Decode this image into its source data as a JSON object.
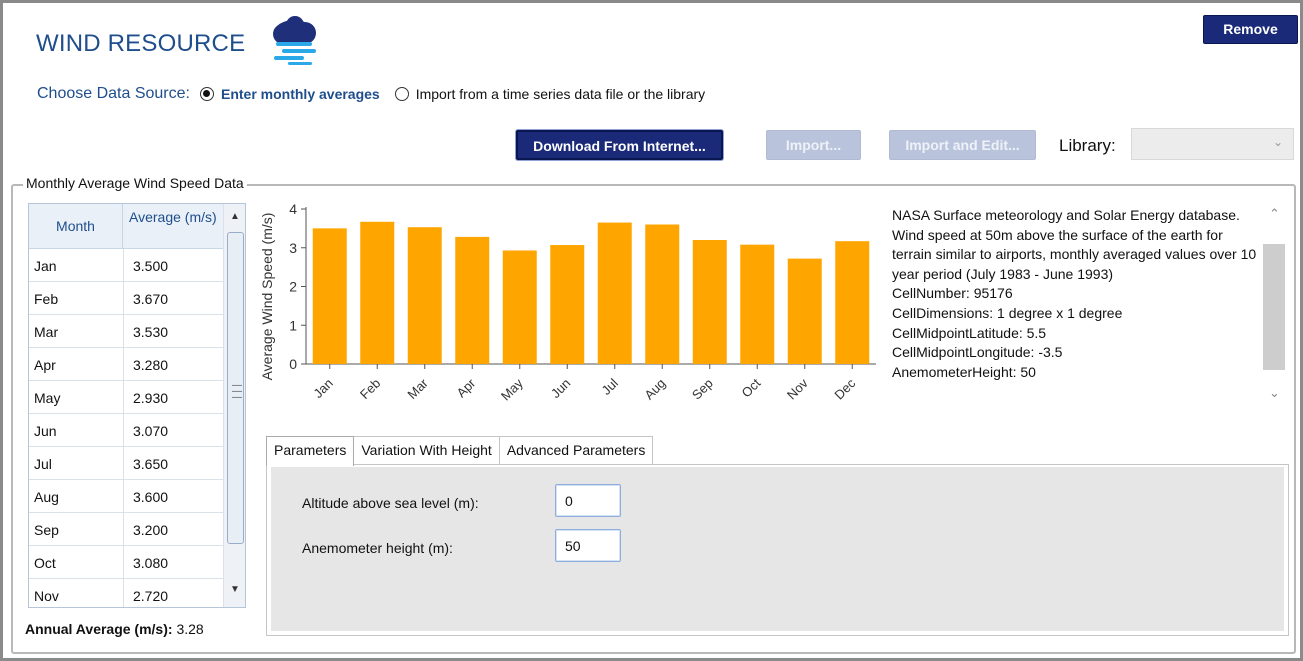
{
  "header": {
    "title": "WIND RESOURCE",
    "remove_label": "Remove"
  },
  "source": {
    "label": "Choose Data Source:",
    "option_monthly": "Enter monthly averages",
    "option_import": "Import from a time series data file or the library",
    "selected": "monthly"
  },
  "toolbar": {
    "download_label": "Download From Internet...",
    "import_label": "Import...",
    "import_edit_label": "Import and Edit...",
    "library_label": "Library:",
    "library_value": ""
  },
  "group": {
    "title": "Monthly Average Wind Speed Data"
  },
  "table": {
    "col_month": "Month",
    "col_avg": "Average (m/s)",
    "rows": [
      {
        "month": "Jan",
        "avg": "3.500"
      },
      {
        "month": "Feb",
        "avg": "3.670"
      },
      {
        "month": "Mar",
        "avg": "3.530"
      },
      {
        "month": "Apr",
        "avg": "3.280"
      },
      {
        "month": "May",
        "avg": "2.930"
      },
      {
        "month": "Jun",
        "avg": "3.070"
      },
      {
        "month": "Jul",
        "avg": "3.650"
      },
      {
        "month": "Aug",
        "avg": "3.600"
      },
      {
        "month": "Sep",
        "avg": "3.200"
      },
      {
        "month": "Oct",
        "avg": "3.080"
      },
      {
        "month": "Nov",
        "avg": "2.720"
      }
    ]
  },
  "annual": {
    "label": "Annual Average (m/s):",
    "value": "3.28"
  },
  "chart_data": {
    "type": "bar",
    "categories": [
      "Jan",
      "Feb",
      "Mar",
      "Apr",
      "May",
      "Jun",
      "Jul",
      "Aug",
      "Sep",
      "Oct",
      "Nov",
      "Dec"
    ],
    "values": [
      3.5,
      3.67,
      3.53,
      3.28,
      2.93,
      3.07,
      3.65,
      3.6,
      3.2,
      3.08,
      2.72,
      3.17
    ],
    "title": "",
    "xlabel": "",
    "ylabel": "Average Wind Speed (m/s)",
    "ylim": [
      0,
      4
    ],
    "yticks": [
      "0",
      "1",
      "2",
      "3",
      "4"
    ],
    "bar_color": "#ffa500",
    "grid": false
  },
  "description": {
    "lines": [
      "NASA Surface meteorology and Solar Energy database.",
      "Wind speed at 50m above the surface of the earth for terrain similar to airports, monthly averaged values over 10 year period (July 1983 - June 1993)",
      "CellNumber: 95176",
      "CellDimensions: 1 degree x 1 degree",
      "CellMidpointLatitude: 5.5",
      "CellMidpointLongitude: -3.5",
      "AnemometerHeight: 50"
    ]
  },
  "tabs": {
    "items": [
      "Parameters",
      "Variation With Height",
      "Advanced Parameters"
    ],
    "active": "Parameters"
  },
  "parameters": {
    "altitude_label": "Altitude above sea level (m):",
    "altitude_value": "0",
    "anemometer_label": "Anemometer height (m):",
    "anemometer_value": "50"
  },
  "colors": {
    "accent_text": "#1f4e8c",
    "primary_button": "#1a2a78",
    "disabled_button": "#b9c4dc",
    "bar": "#ffa500"
  }
}
